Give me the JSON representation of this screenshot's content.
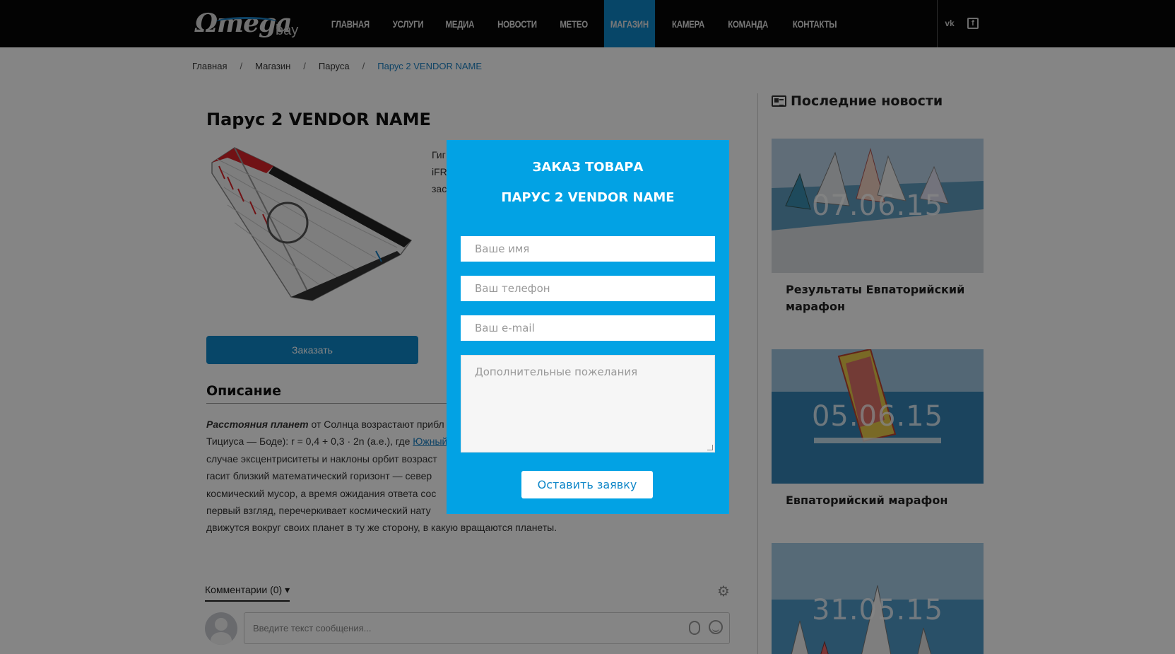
{
  "header": {
    "logo_main": "Ωmega",
    "logo_sub": "bay",
    "nav": [
      {
        "label": "ГЛАВНАЯ"
      },
      {
        "label": "УСЛУГИ"
      },
      {
        "label": "МЕДИА"
      },
      {
        "label": "НОВОСТИ"
      },
      {
        "label": "МЕТЕО"
      },
      {
        "label": "МАГАЗИН",
        "active": true
      },
      {
        "label": "КАМЕРА"
      },
      {
        "label": "КОМАНДА"
      },
      {
        "label": "КОНТАКТЫ"
      }
    ],
    "social": {
      "vk": "vk",
      "facebook": "f"
    }
  },
  "breadcrumb": {
    "items": [
      "Главная",
      "Магазин",
      "Паруса"
    ],
    "current": "Парус 2 VENDOR NAME",
    "separator": "/"
  },
  "product": {
    "title": "Парус 2 VENDOR NAME",
    "teaser_lines": [
      "Гиг",
      "iFR",
      "зас"
    ],
    "order_button": "Заказать",
    "description_heading": "Описание",
    "description": {
      "bold": "Расстояния планет",
      "line1_rest": " от Солнца возрастают прибл",
      "line2_start": "Тициуса — Боде): r = 0,4 + 0,3 · 2n (а.е.), где ",
      "line2_link": "Южный",
      "line3": "случае эксцентриситеты и наклоны орбит возраст",
      "line4": "гасит близкий математический горизонт — север",
      "line5": "космический мусор, а время ожидания ответа сос",
      "line6": "первый взгляд, перечеркивает космический нату",
      "line7": "движутся вокруг своих планет в ту же сторону, в какую вращаются планеты."
    }
  },
  "comments": {
    "tab_label": "Комментарии (0)",
    "tab_caret": "▾",
    "input_placeholder": "Введите текст сообщения..."
  },
  "sidebar": {
    "heading": "Последние новости",
    "news": [
      {
        "date": "07.06.15",
        "title": "Результаты Евпаторийский марафон"
      },
      {
        "date": "05.06.15",
        "title": "Евпаторийский марафон"
      },
      {
        "date": "31.05.15",
        "title": ""
      }
    ]
  },
  "modal": {
    "title": "ЗАКАЗ ТОВАРА",
    "subtitle": "ПАРУС 2 VENDOR NAME",
    "fields": {
      "name_placeholder": "Ваше имя",
      "phone_placeholder": "Ваш телефон",
      "email_placeholder": "Ваш e-mail",
      "wishes_placeholder": "Дополнительные пожелания"
    },
    "submit_label": "Оставить заявку"
  },
  "colors": {
    "accent": "#0e86c8",
    "modal_bg": "#02a2e4",
    "header_bg": "#070707"
  }
}
